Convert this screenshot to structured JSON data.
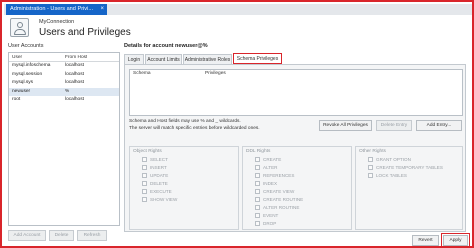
{
  "window": {
    "tab_title": "Administration - Users and Privi...",
    "close_glyph": "×"
  },
  "header": {
    "connection": "MyConnection",
    "title": "Users and Privileges",
    "icon": "user-admin-icon"
  },
  "user_accounts": {
    "title": "User Accounts",
    "columns": [
      "User",
      "From Host"
    ],
    "rows": [
      {
        "user": "mysql.infoschema",
        "host": "localhost"
      },
      {
        "user": "mysql.session",
        "host": "localhost"
      },
      {
        "user": "mysql.sys",
        "host": "localhost"
      },
      {
        "user": "newuser",
        "host": "%"
      },
      {
        "user": "root",
        "host": "localhost"
      }
    ],
    "selected_index": 3,
    "buttons": {
      "add": "Add Account",
      "delete": "Delete",
      "refresh": "Refresh"
    }
  },
  "details": {
    "title": "Details for account newuser@%",
    "tabs": [
      "Login",
      "Account Limits",
      "Administrative Roles",
      "Schema Privileges"
    ],
    "active_tab": "Schema Privileges",
    "grid_columns": [
      "Schema",
      "Privileges"
    ],
    "hint_line1": "Schema and Host fields may use % and _ wildcards.",
    "hint_line2": "The server will match specific entries before wildcarded ones.",
    "buttons": {
      "revoke_all": "Revoke All Privileges",
      "delete_entry": "Delete Entry",
      "add_entry": "Add Entry..."
    },
    "groups": {
      "object": {
        "title": "Object Rights",
        "items": [
          "SELECT",
          "INSERT",
          "UPDATE",
          "DELETE",
          "EXECUTE",
          "SHOW VIEW"
        ]
      },
      "ddl": {
        "title": "DDL Rights",
        "items": [
          "CREATE",
          "ALTER",
          "REFERENCES",
          "INDEX",
          "CREATE VIEW",
          "CREATE ROUTINE",
          "ALTER ROUTINE",
          "EVENT",
          "DROP"
        ]
      },
      "other": {
        "title": "Other Rights",
        "items": [
          "GRANT OPTION",
          "CREATE TEMPORARY TABLES",
          "LOCK TABLES"
        ]
      }
    }
  },
  "footer": {
    "revert": "Revert",
    "apply": "Apply"
  },
  "colors": {
    "accent": "#1565c8",
    "highlight": "#d9252b",
    "selection": "#dde7f2"
  }
}
